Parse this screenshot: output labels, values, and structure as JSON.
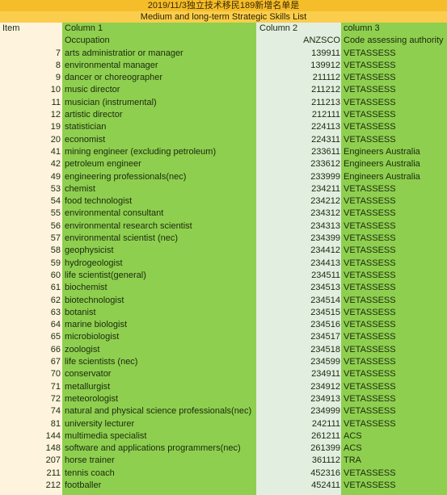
{
  "title": "2019/11/3独立技术移民189新增名单是",
  "subtitle": "Medium and long-term Strategic Skills List",
  "header_row1": {
    "item": "Item",
    "col1": "Column 1",
    "col2": "Column 2",
    "col3": "column 3"
  },
  "header_row2": {
    "item": "",
    "col1": "Occupation",
    "col2": "ANZSCO",
    "col3": "Code assessing authority"
  },
  "colors": {
    "title_bg": "#f6bd2a",
    "subtitle_bg": "#fbcd4c",
    "green": "#8fcf4f",
    "code_bg": "#e2eedf",
    "item_bg": "#fef3dc"
  },
  "rows": [
    {
      "item": "7",
      "occupation": "arts administratior or manager",
      "code": "139911",
      "authority": "VETASSESS"
    },
    {
      "item": "8",
      "occupation": "environmental manager",
      "code": "139912",
      "authority": "VETASSESS"
    },
    {
      "item": "9",
      "occupation": "dancer or choreographer",
      "code": "211112",
      "authority": "VETASSESS"
    },
    {
      "item": "10",
      "occupation": "music director",
      "code": "211212",
      "authority": "VETASSESS"
    },
    {
      "item": "11",
      "occupation": "musician (instrumental)",
      "code": "211213",
      "authority": "VETASSESS"
    },
    {
      "item": "12",
      "occupation": "artistic director",
      "code": "212111",
      "authority": "VETASSESS"
    },
    {
      "item": "19",
      "occupation": "statistician",
      "code": "224113",
      "authority": "VETASSESS"
    },
    {
      "item": "20",
      "occupation": "economist",
      "code": "224311",
      "authority": "VETASSESS"
    },
    {
      "item": "41",
      "occupation": "mining engineer (excluding petroleum)",
      "code": "233611",
      "authority": "Engineers Australia"
    },
    {
      "item": "42",
      "occupation": "petroleum engineer",
      "code": "233612",
      "authority": "Engineers Australia"
    },
    {
      "item": "49",
      "occupation": "engineering professionals(nec)",
      "code": "233999",
      "authority": "Engineers Australia"
    },
    {
      "item": "53",
      "occupation": "chemist",
      "code": "234211",
      "authority": "VETASSESS"
    },
    {
      "item": "54",
      "occupation": "food technologist",
      "code": "234212",
      "authority": "VETASSESS"
    },
    {
      "item": "55",
      "occupation": "environmental consultant",
      "code": "234312",
      "authority": "VETASSESS"
    },
    {
      "item": "56",
      "occupation": "environmental research scientist",
      "code": "234313",
      "authority": "VETASSESS"
    },
    {
      "item": "57",
      "occupation": "environmental scientist (nec)",
      "code": "234399",
      "authority": "VETASSESS"
    },
    {
      "item": "58",
      "occupation": "geophysicist",
      "code": "234412",
      "authority": "VETASSESS"
    },
    {
      "item": "59",
      "occupation": "hydrogeologist",
      "code": "234413",
      "authority": "VETASSESS"
    },
    {
      "item": "60",
      "occupation": "life scientist(general)",
      "code": "234511",
      "authority": "VETASSESS"
    },
    {
      "item": "61",
      "occupation": "biochemist",
      "code": "234513",
      "authority": "VETASSESS"
    },
    {
      "item": "62",
      "occupation": "biotechnologist",
      "code": "234514",
      "authority": "VETASSESS"
    },
    {
      "item": "63",
      "occupation": "botanist",
      "code": "234515",
      "authority": "VETASSESS"
    },
    {
      "item": "64",
      "occupation": "marine biologist",
      "code": "234516",
      "authority": "VETASSESS"
    },
    {
      "item": "65",
      "occupation": "microbiologist",
      "code": "234517",
      "authority": "VETASSESS"
    },
    {
      "item": "66",
      "occupation": "zoologist",
      "code": "234518",
      "authority": "VETASSESS"
    },
    {
      "item": "67",
      "occupation": "life scientists (nec)",
      "code": "234599",
      "authority": "VETASSESS"
    },
    {
      "item": "70",
      "occupation": "conservator",
      "code": "234911",
      "authority": "VETASSESS"
    },
    {
      "item": "71",
      "occupation": "metallurgist",
      "code": "234912",
      "authority": "VETASSESS"
    },
    {
      "item": "72",
      "occupation": "meteorologist",
      "code": "234913",
      "authority": "VETASSESS"
    },
    {
      "item": "74",
      "occupation": "natural and physical science professionals(nec)",
      "code": "234999",
      "authority": "VETASSESS"
    },
    {
      "item": "81",
      "occupation": "university lecturer",
      "code": "242111",
      "authority": "VETASSESS"
    },
    {
      "item": "144",
      "occupation": "multimedia specialist",
      "code": "261211",
      "authority": "ACS"
    },
    {
      "item": "148",
      "occupation": "software and applications programmers(nec)",
      "code": "261399",
      "authority": "ACS"
    },
    {
      "item": "207",
      "occupation": "horse trainer",
      "code": "361112",
      "authority": "TRA"
    },
    {
      "item": "211",
      "occupation": "tennis coach",
      "code": "452316",
      "authority": "VETASSESS"
    },
    {
      "item": "212",
      "occupation": "footballer",
      "code": "452411",
      "authority": "VETASSESS"
    }
  ]
}
